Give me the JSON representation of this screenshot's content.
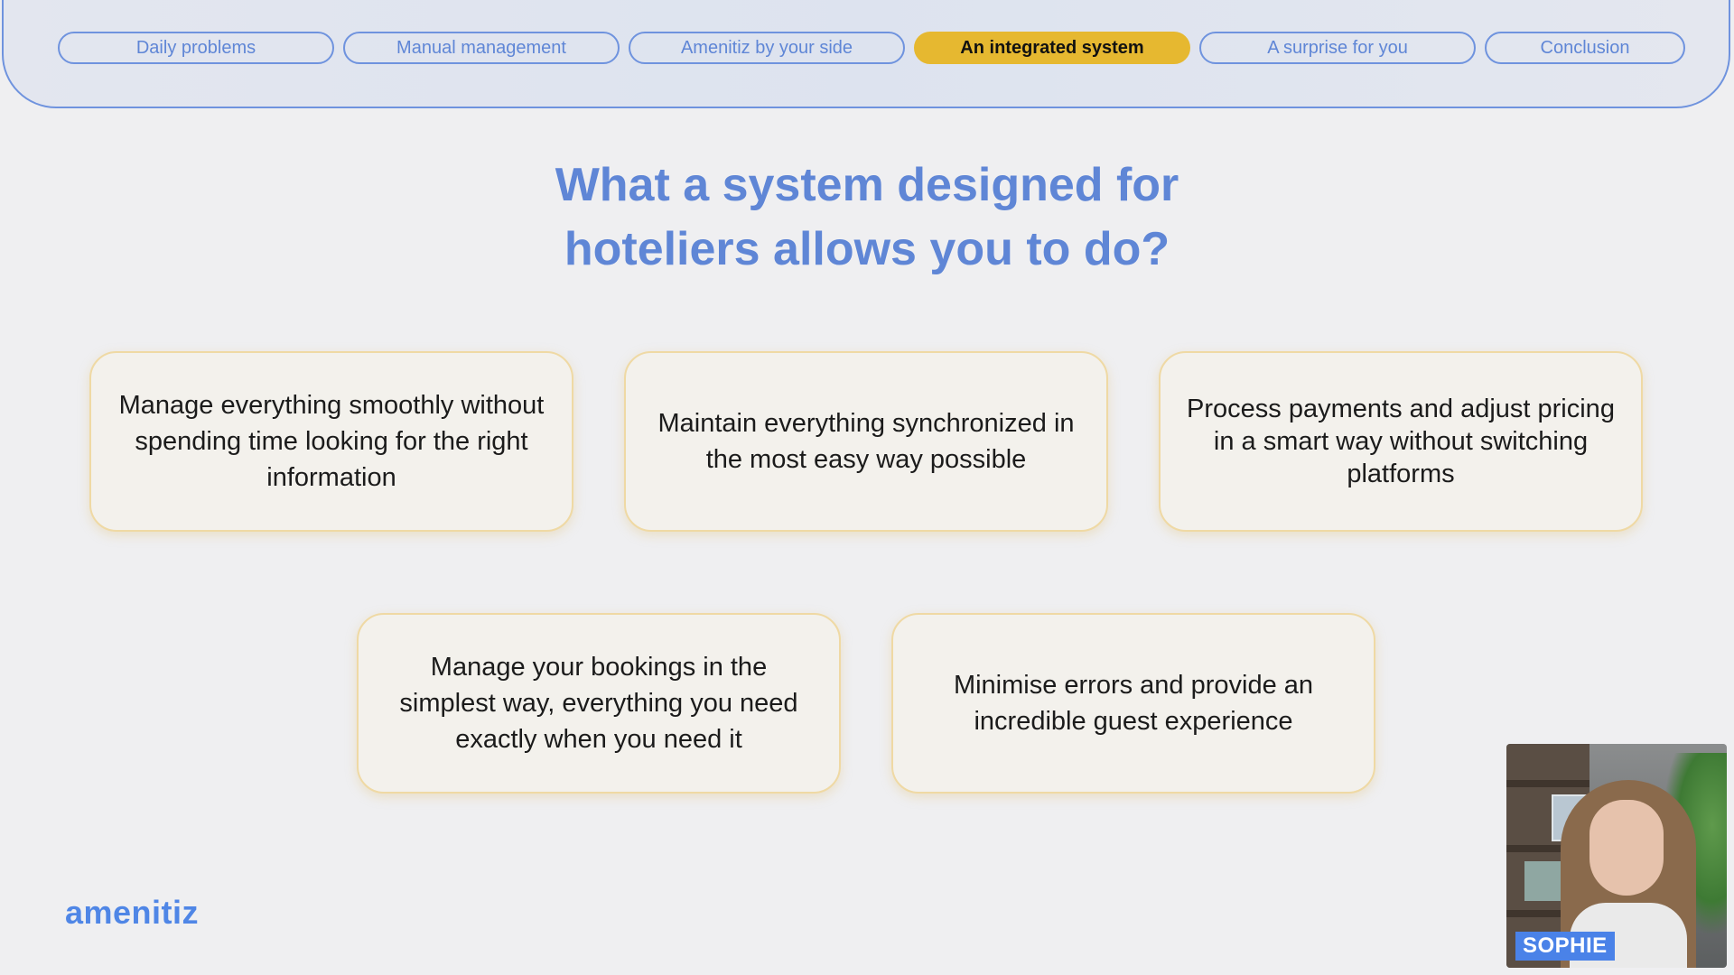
{
  "nav": {
    "tabs": [
      {
        "label": "Daily problems"
      },
      {
        "label": "Manual management"
      },
      {
        "label": "Amenitiz by your side"
      },
      {
        "label": "An integrated system"
      },
      {
        "label": "A surprise for you"
      },
      {
        "label": "Conclusion"
      }
    ],
    "active_index": 3
  },
  "headline": {
    "line1": "What a system designed for",
    "line2": "hoteliers allows you to do?"
  },
  "cards": [
    {
      "text": "Manage everything smoothly without spending time looking for the right information"
    },
    {
      "text": "Maintain everything synchronized in the most easy way possible"
    },
    {
      "text": "Process payments and adjust pricing in a smart way without switching platforms"
    },
    {
      "text": "Manage your bookings in the simplest way, everything you need exactly when you need it"
    },
    {
      "text": "Minimise errors and provide an incredible guest experience"
    }
  ],
  "brand": {
    "logo_text": "amenitiz",
    "accent_color": "#5f86d6",
    "active_color": "#e6b830"
  },
  "presenter": {
    "name": "SOPHIE"
  }
}
